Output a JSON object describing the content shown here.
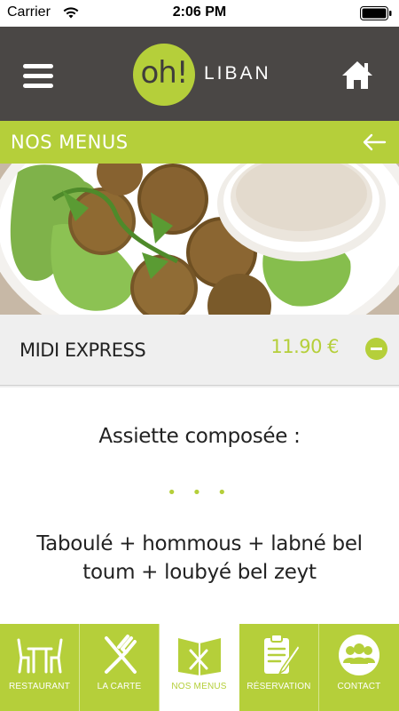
{
  "status_bar": {
    "carrier": "Carrier",
    "time": "2:06 PM",
    "icons": [
      "wifi-icon",
      "battery-icon"
    ]
  },
  "header": {
    "logo_mark": "oh!",
    "logo_text": "LIBAN",
    "icons": [
      "menu-icon",
      "home-icon"
    ]
  },
  "section": {
    "title": "NOS MENUS",
    "back_icon": "back-arrow-icon"
  },
  "menu": {
    "name": "MIDI EXPRESS",
    "price": "11.90 €",
    "expanded": true,
    "toggle_icon": "collapse-icon"
  },
  "card": {
    "heading": "Assiette composée :",
    "separator": "• • •",
    "body": "Taboulé + hommous + labné bel toum + loubyé bel zeyt"
  },
  "tabs": [
    {
      "label": "RESTAURANT",
      "icon": "restaurant-icon",
      "active": false
    },
    {
      "label": "LA CARTE",
      "icon": "fork-knife-icon",
      "active": false
    },
    {
      "label": "NOS MENUS",
      "icon": "menu-book-icon",
      "active": true
    },
    {
      "label": "RÉSERVATION",
      "icon": "clipboard-icon",
      "active": false
    },
    {
      "label": "CONTACT",
      "icon": "contact-group-icon",
      "active": false
    }
  ],
  "colors": {
    "accent": "#b5cf3a",
    "header_bg": "#4a4745",
    "row_bg": "#efefef"
  }
}
